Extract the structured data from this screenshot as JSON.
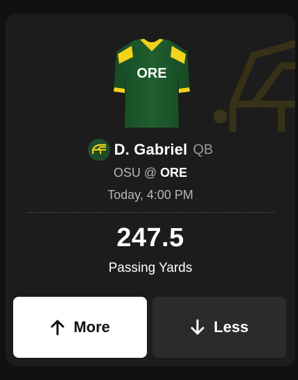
{
  "jersey": {
    "team_text": "ORE",
    "primary_color": "#1e5a2e",
    "accent_color": "#f2d21b"
  },
  "player": {
    "name": "D. Gabriel",
    "position": "QB",
    "team_icon": "helmet-icon"
  },
  "matchup": {
    "away": "OSU",
    "separator": "@",
    "home": "ORE"
  },
  "game_time": "Today, 4:00 PM",
  "projection": {
    "line": "247.5",
    "stat": "Passing Yards"
  },
  "buttons": {
    "more_label": "More",
    "more_icon": "arrow-up-icon",
    "less_label": "Less",
    "less_icon": "arrow-down-icon"
  }
}
